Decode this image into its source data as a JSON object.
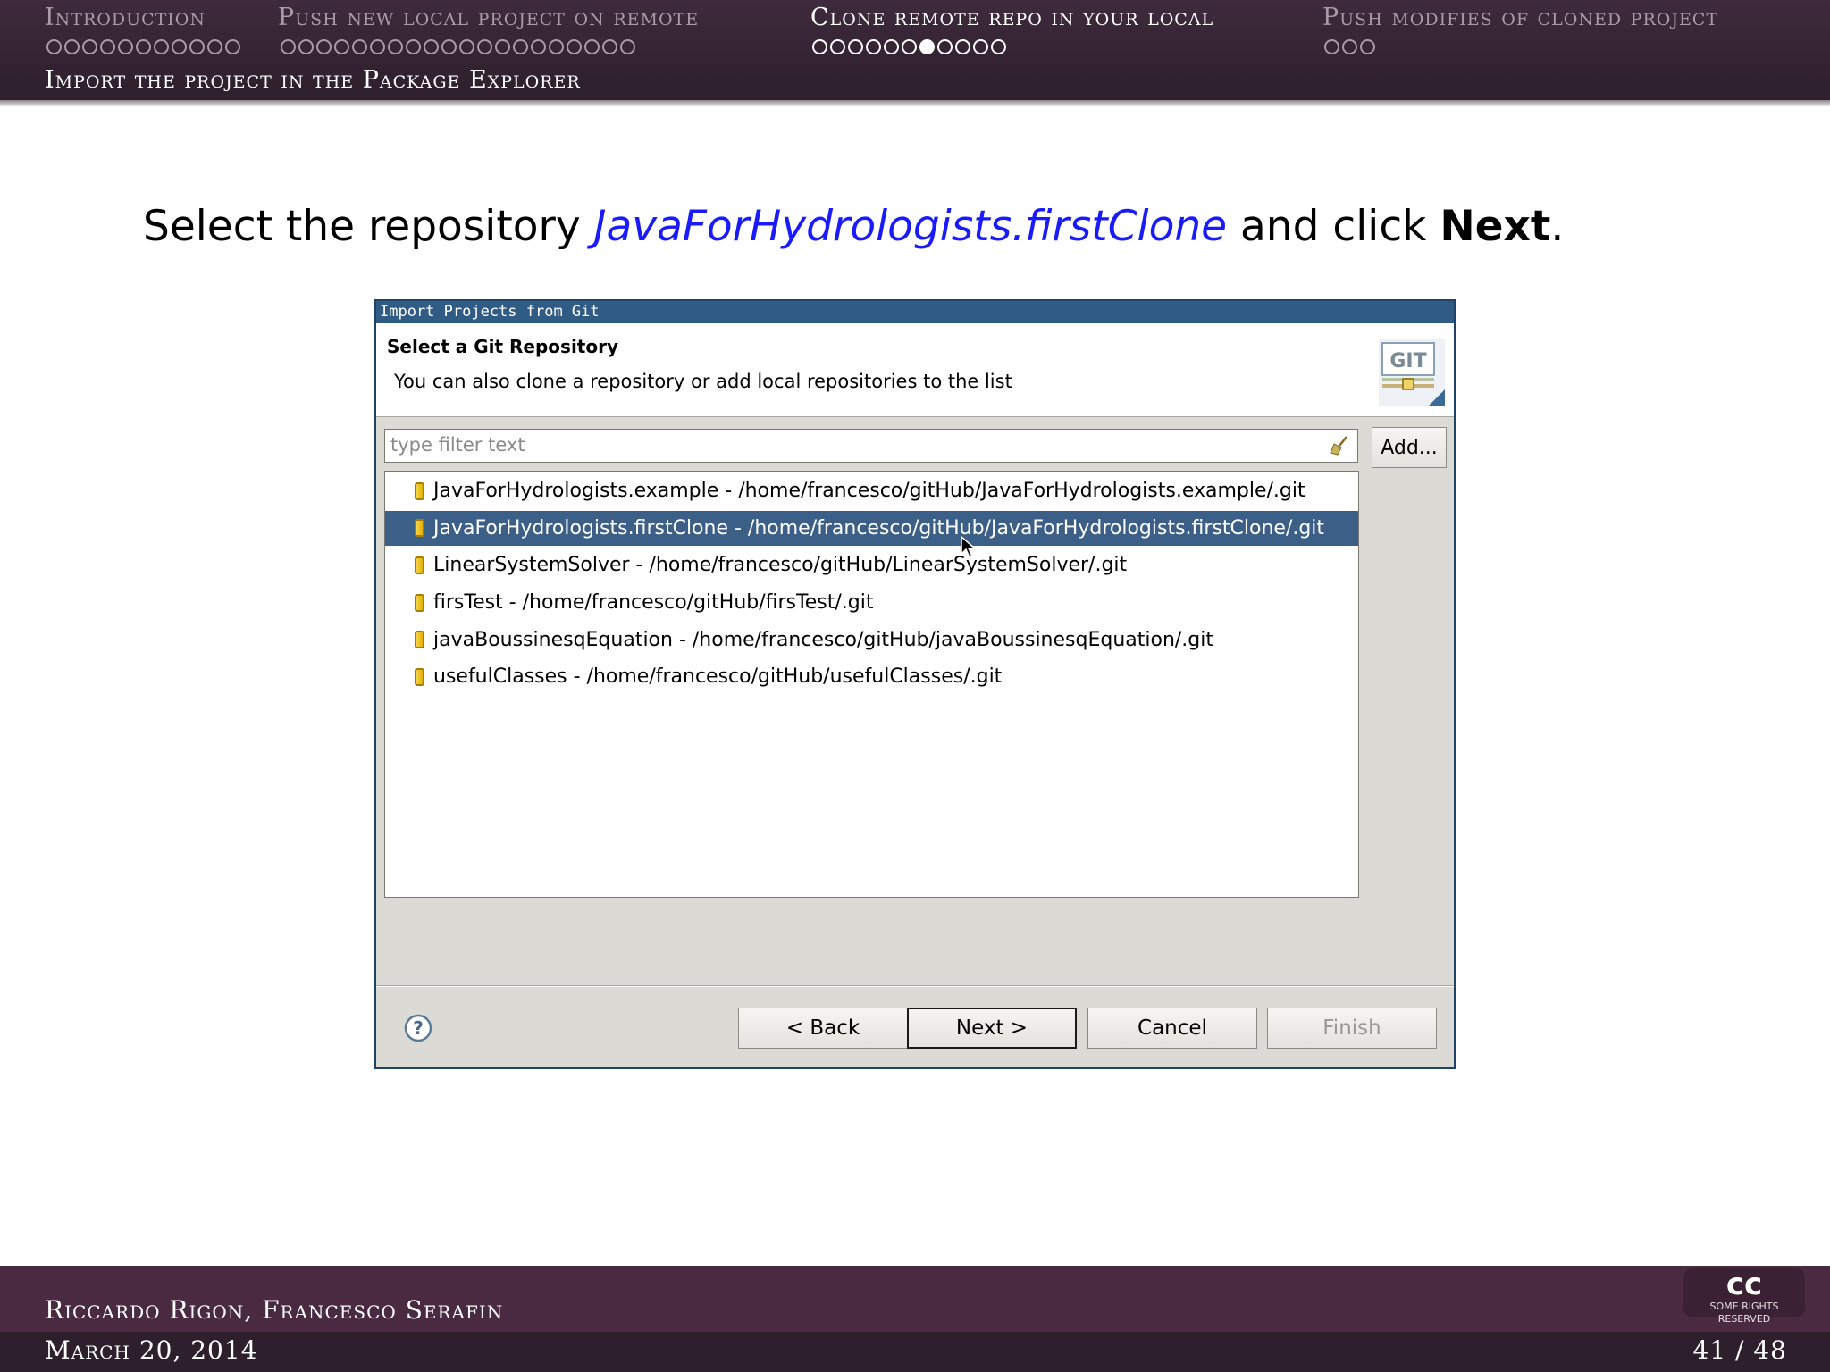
{
  "nav": {
    "sections": [
      {
        "label": "Introduction",
        "dots": 11,
        "filled": -1,
        "active": false
      },
      {
        "label": "Push new local project on remote",
        "dots": 20,
        "filled": -1,
        "active": false
      },
      {
        "label": "Clone remote repo in your local",
        "dots": 11,
        "filled": 6,
        "active": true
      },
      {
        "label": "Push modifies of cloned project",
        "dots": 3,
        "filled": -1,
        "active": false
      }
    ],
    "subsection": "Import the project in the Package Explorer"
  },
  "slide": {
    "instruction_prefix": "Select the repository ",
    "instruction_repo": "JavaForHydrologists.firstClone",
    "instruction_middle": " and click ",
    "instruction_next": "Next",
    "instruction_suffix": "."
  },
  "dialog": {
    "title": "Import Projects from Git",
    "heading": "Select a Git Repository",
    "message": "You can also clone a repository or add local repositories to the list",
    "badge_text": "GIT",
    "filter_placeholder": "type filter text",
    "add_label": "Add...",
    "repositories": [
      "JavaForHydrologists.example - /home/francesco/gitHub/JavaForHydrologists.example/.git",
      "JavaForHydrologists.firstClone - /home/francesco/gitHub/JavaForHydrologists.firstClone/.git",
      "LinearSystemSolver - /home/francesco/gitHub/LinearSystemSolver/.git",
      "firsTest - /home/francesco/gitHub/firsTest/.git",
      "javaBoussinesqEquation - /home/francesco/gitHub/javaBoussinesqEquation/.git",
      "usefulClasses - /home/francesco/gitHub/usefulClasses/.git"
    ],
    "selected_index": 1,
    "buttons": {
      "back": "< Back",
      "next": "Next >",
      "cancel": "Cancel",
      "finish": "Finish"
    }
  },
  "footer": {
    "authors": "Riccardo Rigon, Francesco Serafin",
    "date": "March 20, 2014",
    "page": "41 / 48",
    "cc": "cc",
    "cc_caption": "SOME RIGHTS RESERVED"
  },
  "colors": {
    "header_bg": "#2d1f2c",
    "footer_bg": "#4a2a40",
    "titlebar": "#2f5b84",
    "selection": "#3c5f87",
    "link_blue": "#1a1aff"
  },
  "icons": [
    "help-icon",
    "broom-icon",
    "git-repository-icon",
    "git-badge-icon",
    "mouse-cursor-icon"
  ]
}
